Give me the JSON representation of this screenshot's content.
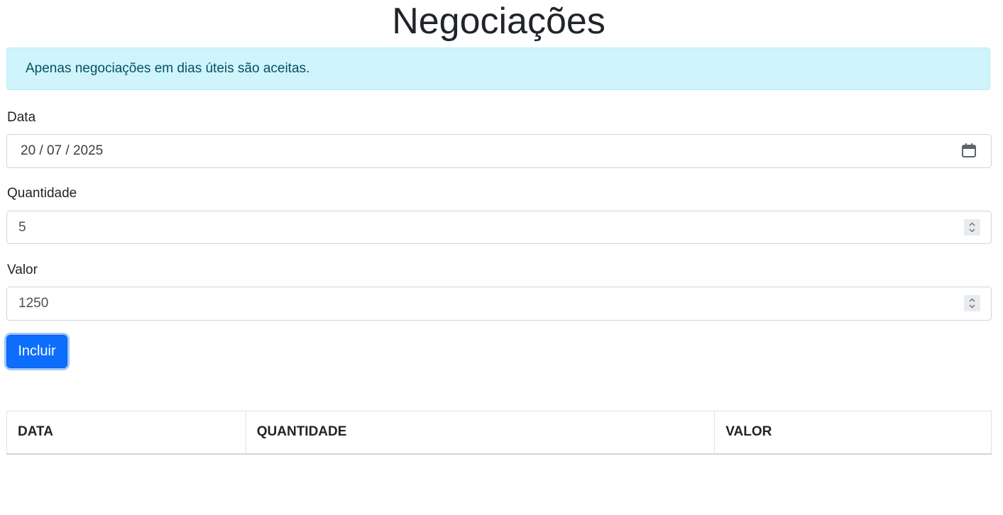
{
  "page": {
    "title": "Negociações"
  },
  "alert": {
    "text": "Apenas negociações em dias úteis são aceitas."
  },
  "form": {
    "data": {
      "label": "Data",
      "value": "20 / 07 / 2025"
    },
    "quantidade": {
      "label": "Quantidade",
      "value": "5"
    },
    "valor": {
      "label": "Valor",
      "value": "1250"
    },
    "submit_label": "Incluir"
  },
  "table": {
    "headers": [
      "DATA",
      "QUANTIDADE",
      "VALOR"
    ]
  },
  "colors": {
    "primary": "#0d6efd",
    "alert_bg": "#cff4fc",
    "alert_text": "#055160"
  },
  "icons": {
    "date": "calendar-icon",
    "spinner": "spinner-up-down-icon"
  }
}
